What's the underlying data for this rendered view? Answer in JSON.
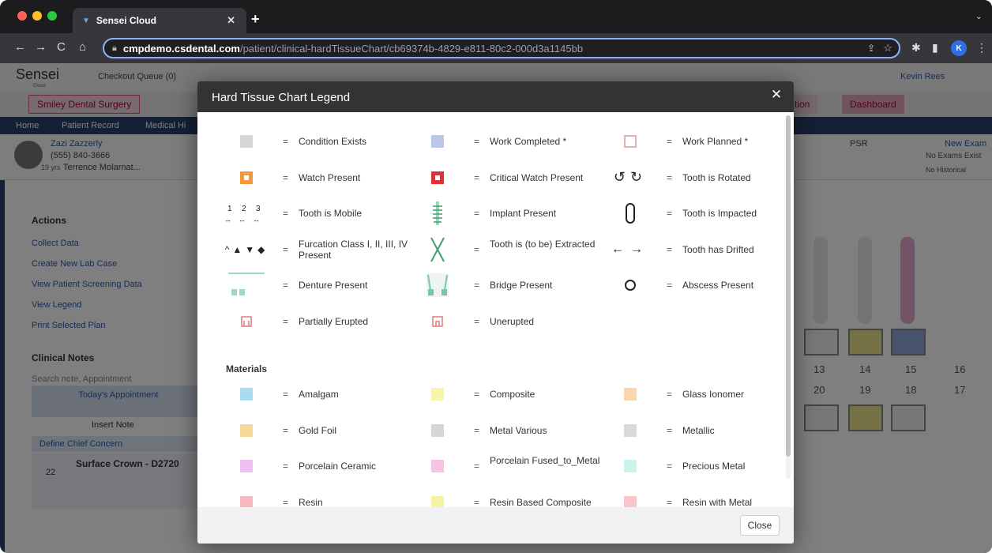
{
  "browser": {
    "tab_title": "Sensei Cloud",
    "url_host": "cmpdemo.csdental.com",
    "url_path": "/patient/clinical-hardTissueChart/cb69374b-4829-e811-80c2-000d3a1145bb",
    "profile_initial": "K"
  },
  "app": {
    "logo": "Sensei",
    "logo_sub": "Cloud",
    "checkout": "Checkout Queue (0)",
    "user": "Kevin Rees",
    "practice": "Smiley Dental Surgery",
    "tab_partial": "tion",
    "tab_dashboard": "Dashboard",
    "menu": [
      "Home",
      "Patient Record",
      "Medical Hi"
    ],
    "patient_name": "Zazi Zazzerly",
    "patient_phone": "(555) 840-3666",
    "patient_age": "19 yrs",
    "patient_doctor": "Terrence Molarnat...",
    "psr": "PSR",
    "new_exam": "New Exam",
    "no_exams": "No Exams Exist",
    "no_historical": "No Historical"
  },
  "sidebar": {
    "actions_title": "Actions",
    "actions": [
      "Collect Data",
      "Create New Lab Case",
      "View Patient Screening Data",
      "View Legend",
      "Print Selected Plan"
    ],
    "clinical_notes": "Clinical Notes",
    "search_placeholder": "Search note, Appointment",
    "appointment": "Today's Appointment",
    "insert_note": "Insert Note",
    "define_concern": "Define Chief Concern",
    "crown_num": "22",
    "crown_title": "Surface Crown - D2720"
  },
  "chart": {
    "numbers_top": [
      "13",
      "14",
      "15",
      "16"
    ],
    "numbers_bottom": [
      "20",
      "19",
      "18",
      "17"
    ]
  },
  "modal": {
    "title": "Hard Tissue Chart Legend",
    "close_label": "Close",
    "eq": "=",
    "legend": [
      {
        "label": "Condition Exists",
        "icon": "condition-exists-icon"
      },
      {
        "label": "Work Completed *",
        "icon": "work-completed-icon"
      },
      {
        "label": "Work Planned *",
        "icon": "work-planned-icon"
      },
      {
        "label": "Watch Present",
        "icon": "watch-icon"
      },
      {
        "label": "Critical Watch Present",
        "icon": "critical-watch-icon"
      },
      {
        "label": "Tooth is Rotated",
        "icon": "rotate-icon"
      },
      {
        "label": "Tooth is Mobile",
        "icon": "mobile-icon",
        "mobile_digits": [
          "1",
          "2",
          "3"
        ]
      },
      {
        "label": "Implant Present",
        "icon": "implant-icon"
      },
      {
        "label": "Tooth is Impacted",
        "icon": "impacted-icon"
      },
      {
        "label": "Furcation Class I, II, III, IV Present",
        "icon": "furcation-icon"
      },
      {
        "label": "Tooth is (to be) Extracted",
        "icon": "extract-icon"
      },
      {
        "label": "Tooth has Drifted",
        "icon": "drift-icon"
      },
      {
        "label": "Denture Present",
        "icon": "denture-icon"
      },
      {
        "label": "Bridge Present",
        "icon": "bridge-icon"
      },
      {
        "label": "Abscess Present",
        "icon": "abscess-icon"
      },
      {
        "label": "Partially Erupted",
        "icon": "partially-erupted-icon"
      },
      {
        "label": "Unerupted",
        "icon": "unerupted-icon"
      }
    ],
    "materials_title": "Materials",
    "materials": [
      {
        "label": "Amalgam",
        "color": "#a8dcf3"
      },
      {
        "label": "Composite",
        "color": "#f6f6a8"
      },
      {
        "label": "Glass Ionomer",
        "color": "#f7d6b0"
      },
      {
        "label": "Gold Foil",
        "color": "#f6d79c"
      },
      {
        "label": "Metal Various",
        "color": "#d6d6d6"
      },
      {
        "label": "Metallic",
        "color": "#d9d9d9"
      },
      {
        "label": "Porcelain Ceramic",
        "color": "#ecc1f2"
      },
      {
        "label": "Porcelain Fused_to_Metal",
        "color": "#f4c3e6"
      },
      {
        "label": "Precious Metal",
        "color": "#c8f4ee"
      },
      {
        "label": "Resin",
        "color": "#f5b8be"
      },
      {
        "label": "Resin Based Composite",
        "color": "#f8f3a2"
      },
      {
        "label": "Resin with Metal",
        "color": "#f7c6cd"
      }
    ]
  }
}
